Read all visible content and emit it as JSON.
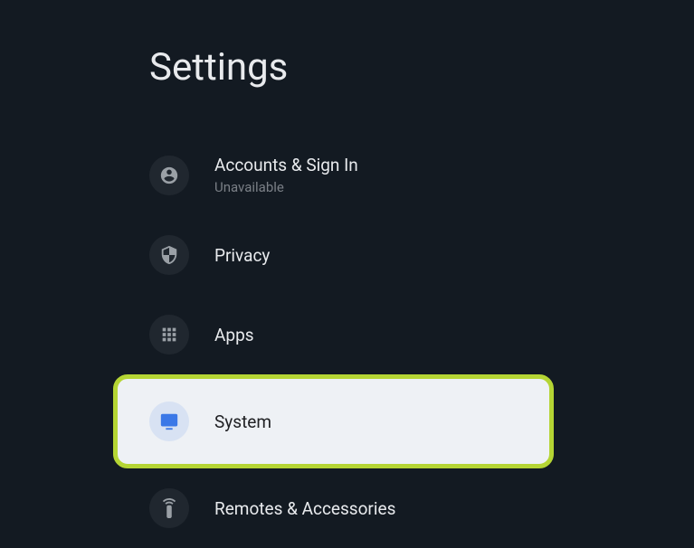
{
  "page": {
    "title": "Settings"
  },
  "items": {
    "accounts": {
      "label": "Accounts & Sign In",
      "subtext": "Unavailable"
    },
    "privacy": {
      "label": "Privacy"
    },
    "apps": {
      "label": "Apps"
    },
    "system": {
      "label": "System"
    },
    "remotes": {
      "label": "Remotes & Accessories"
    }
  },
  "colors": {
    "background": "#131a22",
    "highlight_border": "#b5d534",
    "highlight_bg": "#eef1f5",
    "accent": "#3b78e7"
  }
}
